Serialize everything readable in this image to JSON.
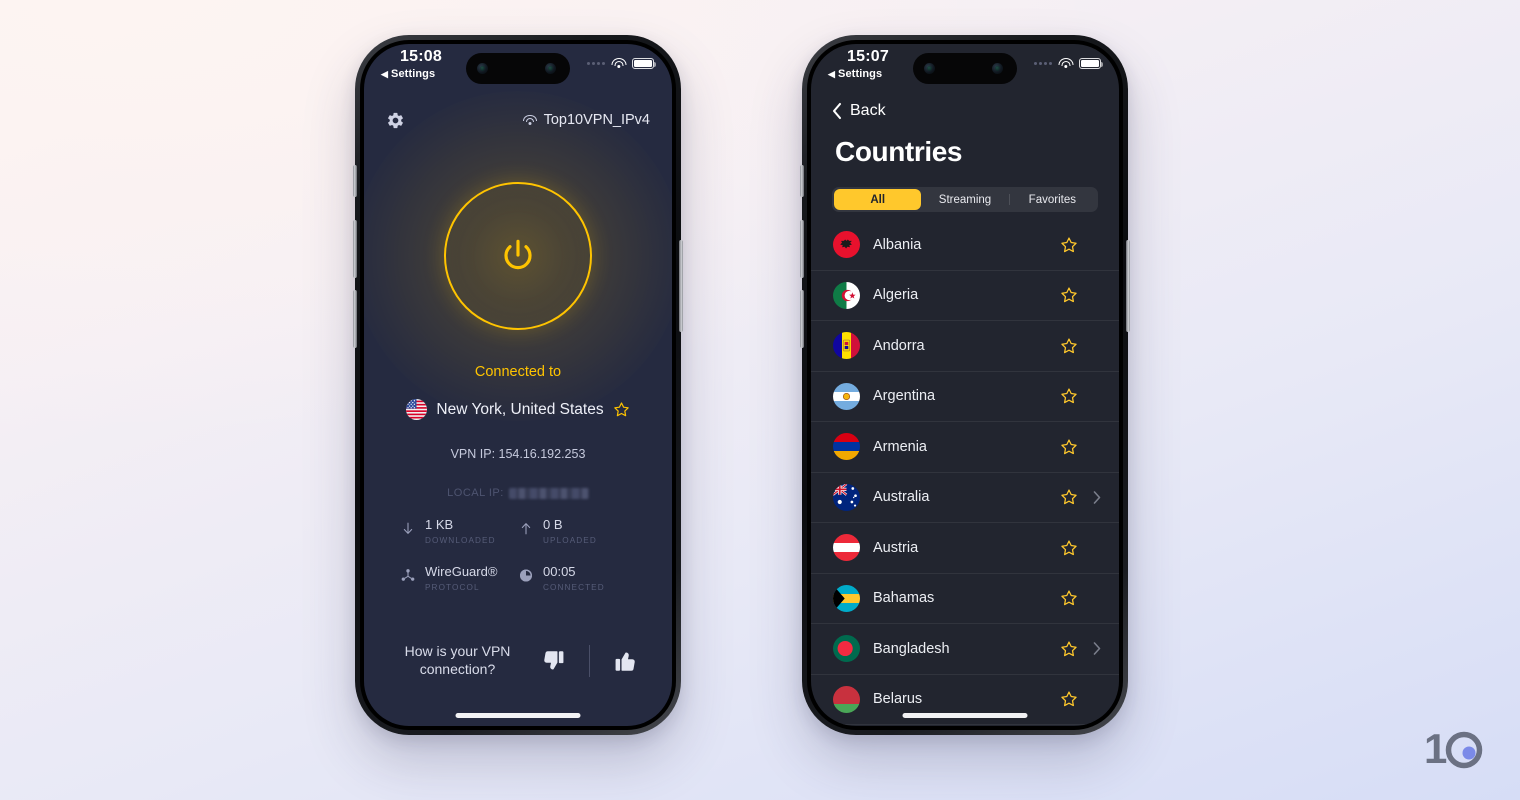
{
  "brand": {
    "logo_text": "10",
    "accent_yellow": "#FFC400",
    "accent_yellow_alt": "#FFC82C",
    "dot_blue": "#7b8ae8"
  },
  "background": {
    "top_color": "#fbf2f1",
    "bottom_color": "#d6ddf6"
  },
  "left_phone": {
    "status_bar": {
      "time": "15:08",
      "back_label": "Settings",
      "back_arrow": "◀"
    },
    "screen_bg": "#252a40",
    "top_bar": {
      "settings_icon": "gear-icon",
      "wifi_icon": "wifi-icon",
      "wifi_name": "Top10VPN_IPv4"
    },
    "power_button": {
      "icon": "power-icon",
      "state": "on"
    },
    "connection": {
      "connected_label": "Connected to",
      "location": "New York, United States",
      "flag": "united-states-flag",
      "favorite_icon": "star-outline-icon",
      "vpn_ip": "VPN IP: 154.16.192.253",
      "local_ip_label": "LOCAL IP:",
      "local_ip_value_hidden": true
    },
    "stats": [
      {
        "icon": "arrow-down-icon",
        "value": "1 KB",
        "label": "DOWNLOADED"
      },
      {
        "icon": "arrow-up-icon",
        "value": "0 B",
        "label": "UPLOADED"
      },
      {
        "icon": "protocol-icon",
        "value": "WireGuard®",
        "label": "PROTOCOL"
      },
      {
        "icon": "timer-icon",
        "value": "00:05",
        "label": "CONNECTED"
      }
    ],
    "feedback": {
      "question": "How is your VPN connection?",
      "thumbs_down_icon": "thumbs-down-icon",
      "thumbs_up_icon": "thumbs-up-icon"
    }
  },
  "right_phone": {
    "status_bar": {
      "time": "15:07",
      "back_label": "Settings",
      "back_arrow": "◀"
    },
    "screen_bg": "#22252f",
    "nav": {
      "back_label": "Back",
      "back_icon": "chevron-left-icon"
    },
    "title": "Countries",
    "tabs": [
      {
        "label": "All",
        "active": true
      },
      {
        "label": "Streaming",
        "active": false
      },
      {
        "label": "Favorites",
        "active": false
      }
    ],
    "countries": [
      {
        "name": "Albania",
        "flag": "albania",
        "favorite": false,
        "has_cities": false
      },
      {
        "name": "Algeria",
        "flag": "algeria",
        "favorite": false,
        "has_cities": false
      },
      {
        "name": "Andorra",
        "flag": "andorra",
        "favorite": false,
        "has_cities": false
      },
      {
        "name": "Argentina",
        "flag": "argentina",
        "favorite": false,
        "has_cities": false
      },
      {
        "name": "Armenia",
        "flag": "armenia",
        "favorite": false,
        "has_cities": false
      },
      {
        "name": "Australia",
        "flag": "australia",
        "favorite": false,
        "has_cities": true
      },
      {
        "name": "Austria",
        "flag": "austria",
        "favorite": false,
        "has_cities": false
      },
      {
        "name": "Bahamas",
        "flag": "bahamas",
        "favorite": false,
        "has_cities": false
      },
      {
        "name": "Bangladesh",
        "flag": "bangladesh",
        "favorite": false,
        "has_cities": true
      },
      {
        "name": "Belarus",
        "flag": "belarus",
        "favorite": false,
        "has_cities": false
      },
      {
        "name": "",
        "flag": "belgium",
        "favorite": false,
        "has_cities": false
      }
    ]
  }
}
